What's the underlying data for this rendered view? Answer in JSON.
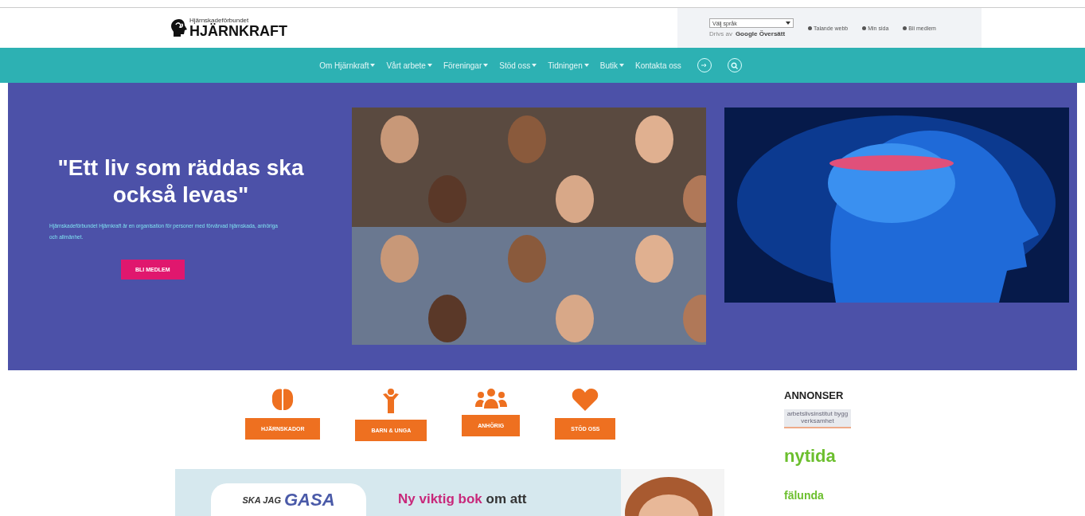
{
  "header": {
    "logo_small": "Hjärnskadeförbundet",
    "logo_large": "HJÄRNKRAFT",
    "language_select": {
      "value": "Välj språk"
    },
    "translate_note": "Drivs av",
    "translate_brand": "Google Översätt",
    "links": [
      {
        "label": "Talande webb"
      },
      {
        "label": "Min sida"
      },
      {
        "label": "Bli medlem"
      }
    ]
  },
  "nav": {
    "items": [
      {
        "label": "Om Hjärnkraft",
        "dropdown": true
      },
      {
        "label": "Vårt arbete",
        "dropdown": true
      },
      {
        "label": "Föreningar",
        "dropdown": true
      },
      {
        "label": "Stöd oss",
        "dropdown": true
      },
      {
        "label": "Tidningen",
        "dropdown": true
      },
      {
        "label": "Butik",
        "dropdown": true
      },
      {
        "label": "Kontakta oss",
        "dropdown": false
      }
    ]
  },
  "hero": {
    "heading": "\"Ett liv som räddas ska också levas\"",
    "text": "Hjärnskadeförbundet Hjärnkraft är en organisation för personer med förvärvad hjärnskada, anhöriga och allmänhet.",
    "button": "BLI MEDLEM"
  },
  "topics": [
    {
      "kind": "brain",
      "label": "HJÄRNSKADOR"
    },
    {
      "kind": "child",
      "label": "BARN & UNGA"
    },
    {
      "kind": "group",
      "label": "ANHÖRIG"
    },
    {
      "kind": "heart",
      "label": "STÖD OSS"
    }
  ],
  "banner": {
    "tag_small": "SKA JAG",
    "tag_large": "GASA",
    "headline": "**Ny viktig bok** om att"
  },
  "ads": {
    "title": "ANNONSER",
    "items": [
      {
        "kind": "box",
        "text": "arbetslivsinstitut bygg verksamhet"
      },
      {
        "kind": "word",
        "text": "nytida"
      },
      {
        "kind": "word",
        "text": "fälunda"
      }
    ]
  }
}
